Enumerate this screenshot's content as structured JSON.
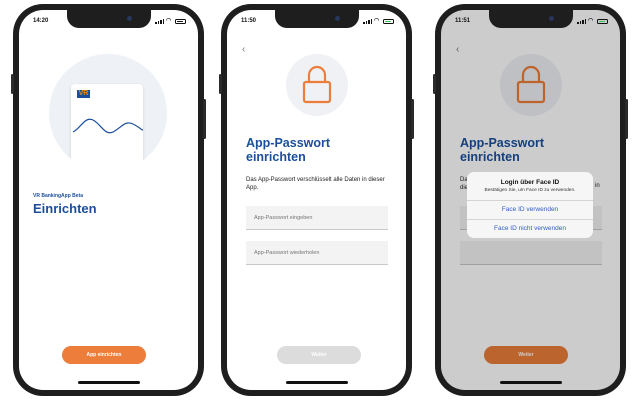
{
  "phones": [
    {
      "status_time": "14:20",
      "brand_logo": "VR",
      "app_label": "VR BankingApp Beta",
      "title": "Einrichten",
      "cta": "App einrichten"
    },
    {
      "status_time": "11:50",
      "back_glyph": "‹",
      "title": "App-Passwort einrichten",
      "description": "Das App-Passwort verschlüsselt alle Daten in dieser App.",
      "field1_placeholder": "App-Passwort eingeben",
      "field2_placeholder": "App-Passwort wiederholen",
      "cta": "Weiter"
    },
    {
      "status_time": "11:51",
      "back_glyph": "‹",
      "title": "App-Passwort einrichten",
      "desc_fragment_left": "Da",
      "desc_fragment_left2": "die",
      "desc_fragment_right": "in",
      "dialog": {
        "title": "Login über Face ID",
        "message": "Bestätigen Sie, um Face ID zu verwenden.",
        "confirm": "Face ID verwenden",
        "decline": "Face ID nicht verwenden"
      },
      "cta": "Weiter"
    }
  ],
  "colors": {
    "brand_blue": "#1b4f9c",
    "accent_orange": "#ec7d3a",
    "dialog_link": "#2f5fbf",
    "disabled": "#dcdcdc"
  },
  "icons": [
    "lock-icon",
    "signal-icon",
    "wifi-icon",
    "battery-icon",
    "back-chevron-icon"
  ]
}
